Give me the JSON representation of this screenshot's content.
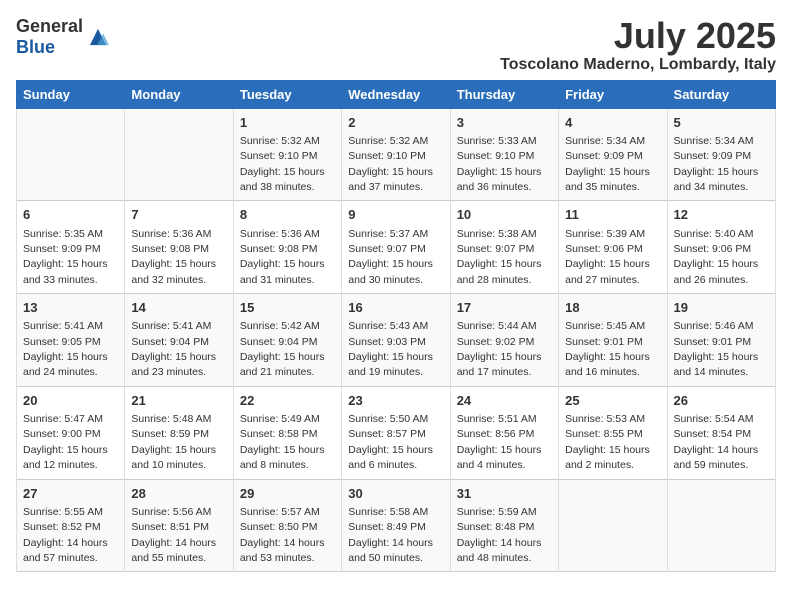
{
  "header": {
    "logo": {
      "general": "General",
      "blue": "Blue"
    },
    "month": "July 2025",
    "location": "Toscolano Maderno, Lombardy, Italy"
  },
  "weekdays": [
    "Sunday",
    "Monday",
    "Tuesday",
    "Wednesday",
    "Thursday",
    "Friday",
    "Saturday"
  ],
  "weeks": [
    [
      {
        "day": null,
        "info": null
      },
      {
        "day": null,
        "info": null
      },
      {
        "day": "1",
        "info": "Sunrise: 5:32 AM\nSunset: 9:10 PM\nDaylight: 15 hours\nand 38 minutes."
      },
      {
        "day": "2",
        "info": "Sunrise: 5:32 AM\nSunset: 9:10 PM\nDaylight: 15 hours\nand 37 minutes."
      },
      {
        "day": "3",
        "info": "Sunrise: 5:33 AM\nSunset: 9:10 PM\nDaylight: 15 hours\nand 36 minutes."
      },
      {
        "day": "4",
        "info": "Sunrise: 5:34 AM\nSunset: 9:09 PM\nDaylight: 15 hours\nand 35 minutes."
      },
      {
        "day": "5",
        "info": "Sunrise: 5:34 AM\nSunset: 9:09 PM\nDaylight: 15 hours\nand 34 minutes."
      }
    ],
    [
      {
        "day": "6",
        "info": "Sunrise: 5:35 AM\nSunset: 9:09 PM\nDaylight: 15 hours\nand 33 minutes."
      },
      {
        "day": "7",
        "info": "Sunrise: 5:36 AM\nSunset: 9:08 PM\nDaylight: 15 hours\nand 32 minutes."
      },
      {
        "day": "8",
        "info": "Sunrise: 5:36 AM\nSunset: 9:08 PM\nDaylight: 15 hours\nand 31 minutes."
      },
      {
        "day": "9",
        "info": "Sunrise: 5:37 AM\nSunset: 9:07 PM\nDaylight: 15 hours\nand 30 minutes."
      },
      {
        "day": "10",
        "info": "Sunrise: 5:38 AM\nSunset: 9:07 PM\nDaylight: 15 hours\nand 28 minutes."
      },
      {
        "day": "11",
        "info": "Sunrise: 5:39 AM\nSunset: 9:06 PM\nDaylight: 15 hours\nand 27 minutes."
      },
      {
        "day": "12",
        "info": "Sunrise: 5:40 AM\nSunset: 9:06 PM\nDaylight: 15 hours\nand 26 minutes."
      }
    ],
    [
      {
        "day": "13",
        "info": "Sunrise: 5:41 AM\nSunset: 9:05 PM\nDaylight: 15 hours\nand 24 minutes."
      },
      {
        "day": "14",
        "info": "Sunrise: 5:41 AM\nSunset: 9:04 PM\nDaylight: 15 hours\nand 23 minutes."
      },
      {
        "day": "15",
        "info": "Sunrise: 5:42 AM\nSunset: 9:04 PM\nDaylight: 15 hours\nand 21 minutes."
      },
      {
        "day": "16",
        "info": "Sunrise: 5:43 AM\nSunset: 9:03 PM\nDaylight: 15 hours\nand 19 minutes."
      },
      {
        "day": "17",
        "info": "Sunrise: 5:44 AM\nSunset: 9:02 PM\nDaylight: 15 hours\nand 17 minutes."
      },
      {
        "day": "18",
        "info": "Sunrise: 5:45 AM\nSunset: 9:01 PM\nDaylight: 15 hours\nand 16 minutes."
      },
      {
        "day": "19",
        "info": "Sunrise: 5:46 AM\nSunset: 9:01 PM\nDaylight: 15 hours\nand 14 minutes."
      }
    ],
    [
      {
        "day": "20",
        "info": "Sunrise: 5:47 AM\nSunset: 9:00 PM\nDaylight: 15 hours\nand 12 minutes."
      },
      {
        "day": "21",
        "info": "Sunrise: 5:48 AM\nSunset: 8:59 PM\nDaylight: 15 hours\nand 10 minutes."
      },
      {
        "day": "22",
        "info": "Sunrise: 5:49 AM\nSunset: 8:58 PM\nDaylight: 15 hours\nand 8 minutes."
      },
      {
        "day": "23",
        "info": "Sunrise: 5:50 AM\nSunset: 8:57 PM\nDaylight: 15 hours\nand 6 minutes."
      },
      {
        "day": "24",
        "info": "Sunrise: 5:51 AM\nSunset: 8:56 PM\nDaylight: 15 hours\nand 4 minutes."
      },
      {
        "day": "25",
        "info": "Sunrise: 5:53 AM\nSunset: 8:55 PM\nDaylight: 15 hours\nand 2 minutes."
      },
      {
        "day": "26",
        "info": "Sunrise: 5:54 AM\nSunset: 8:54 PM\nDaylight: 14 hours\nand 59 minutes."
      }
    ],
    [
      {
        "day": "27",
        "info": "Sunrise: 5:55 AM\nSunset: 8:52 PM\nDaylight: 14 hours\nand 57 minutes."
      },
      {
        "day": "28",
        "info": "Sunrise: 5:56 AM\nSunset: 8:51 PM\nDaylight: 14 hours\nand 55 minutes."
      },
      {
        "day": "29",
        "info": "Sunrise: 5:57 AM\nSunset: 8:50 PM\nDaylight: 14 hours\nand 53 minutes."
      },
      {
        "day": "30",
        "info": "Sunrise: 5:58 AM\nSunset: 8:49 PM\nDaylight: 14 hours\nand 50 minutes."
      },
      {
        "day": "31",
        "info": "Sunrise: 5:59 AM\nSunset: 8:48 PM\nDaylight: 14 hours\nand 48 minutes."
      },
      {
        "day": null,
        "info": null
      },
      {
        "day": null,
        "info": null
      }
    ]
  ]
}
